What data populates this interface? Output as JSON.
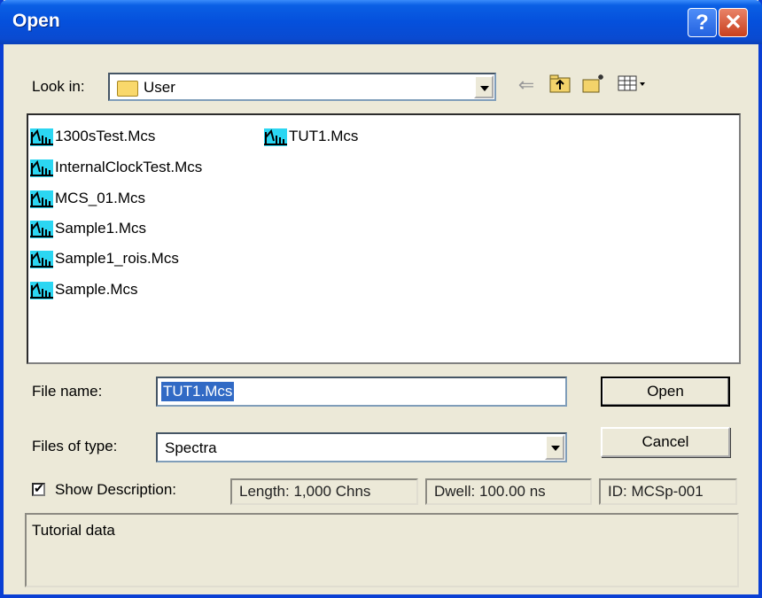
{
  "window": {
    "title": "Open"
  },
  "look_in": {
    "label": "Look in:",
    "value": "User"
  },
  "toolbar_icons": [
    "back-arrow-icon",
    "up-folder-icon",
    "new-folder-icon",
    "view-menu-icon"
  ],
  "files": [
    {
      "name": "1300sTest.Mcs"
    },
    {
      "name": "InternalClockTest.Mcs"
    },
    {
      "name": "MCS_01.Mcs"
    },
    {
      "name": "Sample1.Mcs"
    },
    {
      "name": "Sample1_rois.Mcs"
    },
    {
      "name": "Sample.Mcs"
    },
    {
      "name": "TUT1.Mcs"
    }
  ],
  "file_name": {
    "label": "File name:",
    "value": "TUT1.Mcs"
  },
  "file_type": {
    "label": "Files of type:",
    "value": "Spectra"
  },
  "buttons": {
    "open": "Open",
    "cancel": "Cancel"
  },
  "show_description": {
    "label": "Show Description:",
    "checked": true
  },
  "info": {
    "length": "Length: 1,000 Chns",
    "dwell": "Dwell: 100.00 ns",
    "id": "ID: MCSp-001"
  },
  "description_text": "Tutorial data",
  "colors": {
    "title_bar": "#0a5fe4",
    "selection": "#316ac5",
    "dialog_bg": "#ece9d8"
  }
}
